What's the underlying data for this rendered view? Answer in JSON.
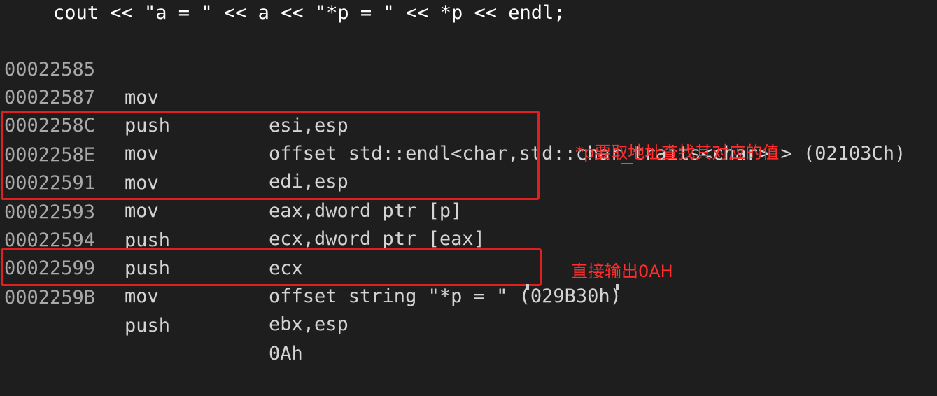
{
  "source_line": "cout << \"a = \" << a << \"*p = \" << *p << endl;",
  "instructions": [
    {
      "address": "00022585",
      "mnemonic": "mov",
      "operands": "esi,esp"
    },
    {
      "address": "00022587",
      "mnemonic": "push",
      "operands": "offset std::endl<char,std::char_traits<char> > (02103Ch)"
    },
    {
      "address": "0002258C",
      "mnemonic": "mov",
      "operands": "edi,esp"
    },
    {
      "address": "0002258E",
      "mnemonic": "mov",
      "operands": "eax,dword ptr [p]"
    },
    {
      "address": "00022591",
      "mnemonic": "mov",
      "operands": "ecx,dword ptr [eax]"
    },
    {
      "address": "00022593",
      "mnemonic": "push",
      "operands": "ecx"
    },
    {
      "address": "00022594",
      "mnemonic": "push",
      "operands": "offset string \"*p = \" (029B30h)"
    },
    {
      "address": "00022599",
      "mnemonic": "mov",
      "operands": "ebx,esp"
    },
    {
      "address": "0002259B",
      "mnemonic": "push",
      "operands": "0Ah"
    }
  ],
  "annotations": {
    "deref_note": "*p要取地址查找其对应的值",
    "endl_note": "直接输出0AH"
  },
  "colors": {
    "background": "#1e1e1e",
    "text": "#d4d4d4",
    "address": "#a9a9a9",
    "highlight": "#e02020",
    "note": "#ff2e2e"
  }
}
